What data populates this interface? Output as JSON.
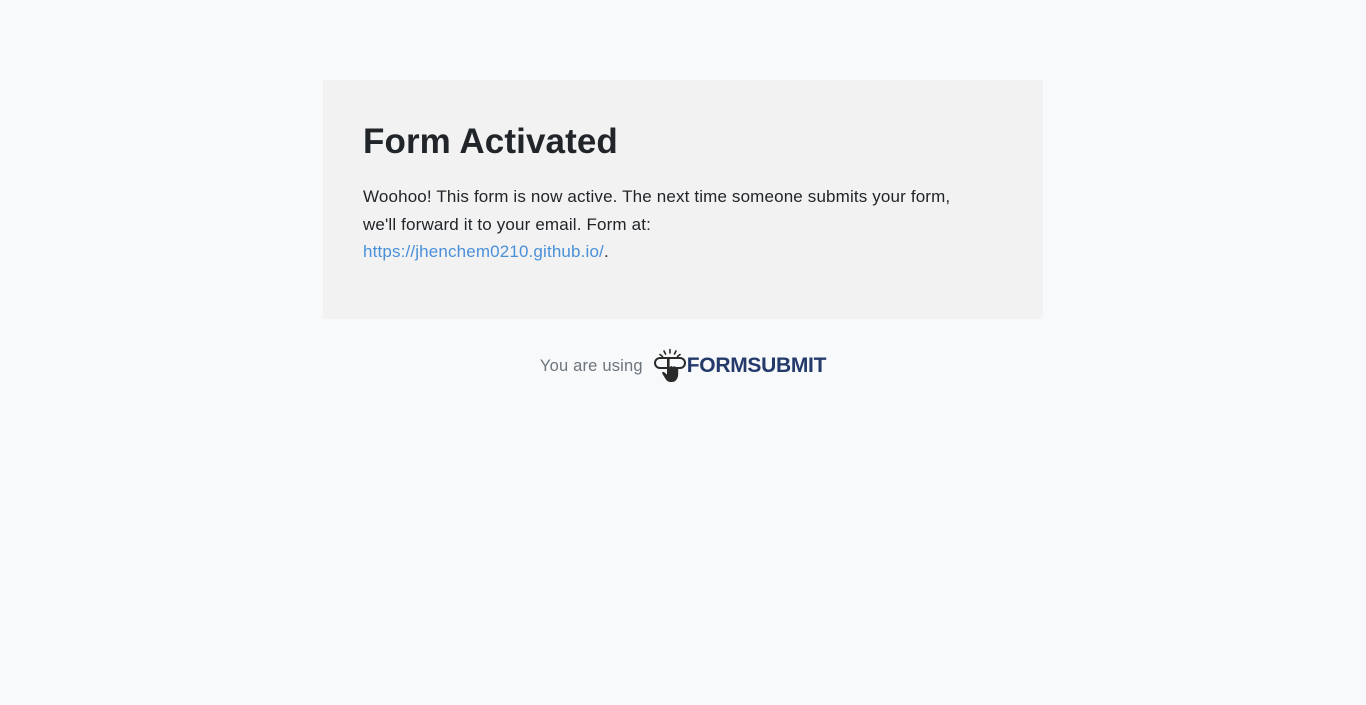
{
  "card": {
    "title": "Form Activated",
    "message_prefix": "Woohoo! This form is now active. The next time someone submits your form, we'll forward it to your email. Form at: ",
    "link_text": "https://jhenchem0210.github.io/",
    "message_suffix": "."
  },
  "footer": {
    "text": "You are using",
    "brand_name": "FORMSUBMIT",
    "brand_icon": "hand-pointer-icon"
  },
  "colors": {
    "background": "#f8f9fa",
    "card_background": "#f2f2f2",
    "link": "#4a90d9",
    "brand": "#233a6b"
  }
}
